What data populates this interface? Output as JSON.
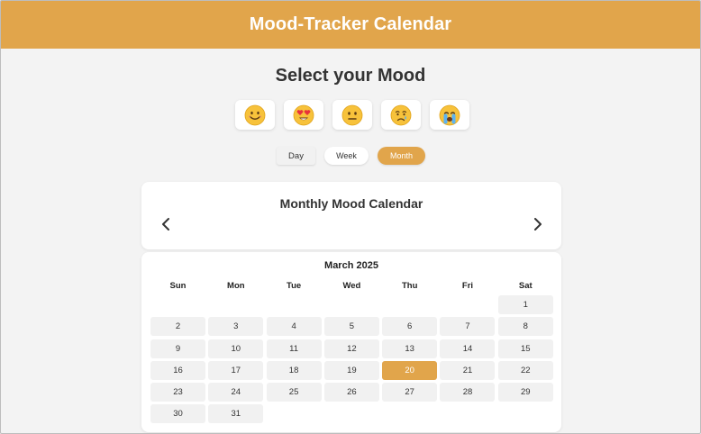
{
  "header": {
    "title": "Mood-Tracker Calendar",
    "color": "#e1a54b"
  },
  "mood": {
    "heading": "Select your Mood",
    "options": [
      {
        "icon": "smiling-face-icon"
      },
      {
        "icon": "heart-eyes-face-icon"
      },
      {
        "icon": "neutral-face-icon"
      },
      {
        "icon": "crying-face-icon"
      },
      {
        "icon": "loudly-crying-face-icon"
      }
    ]
  },
  "views": {
    "day_label": "Day",
    "week_label": "Week",
    "month_label": "Month",
    "active": "Month"
  },
  "calendar": {
    "title": "Monthly Mood Calendar",
    "month_label": "March 2025",
    "weekdays": [
      "Sun",
      "Mon",
      "Tue",
      "Wed",
      "Thu",
      "Fri",
      "Sat"
    ],
    "days": [
      "",
      "",
      "",
      "",
      "",
      "",
      "1",
      "2",
      "3",
      "4",
      "5",
      "6",
      "7",
      "8",
      "9",
      "10",
      "11",
      "12",
      "13",
      "14",
      "15",
      "16",
      "17",
      "18",
      "19",
      "20",
      "21",
      "22",
      "23",
      "24",
      "25",
      "26",
      "27",
      "28",
      "29",
      "30",
      "31"
    ],
    "selected_day": "20"
  }
}
